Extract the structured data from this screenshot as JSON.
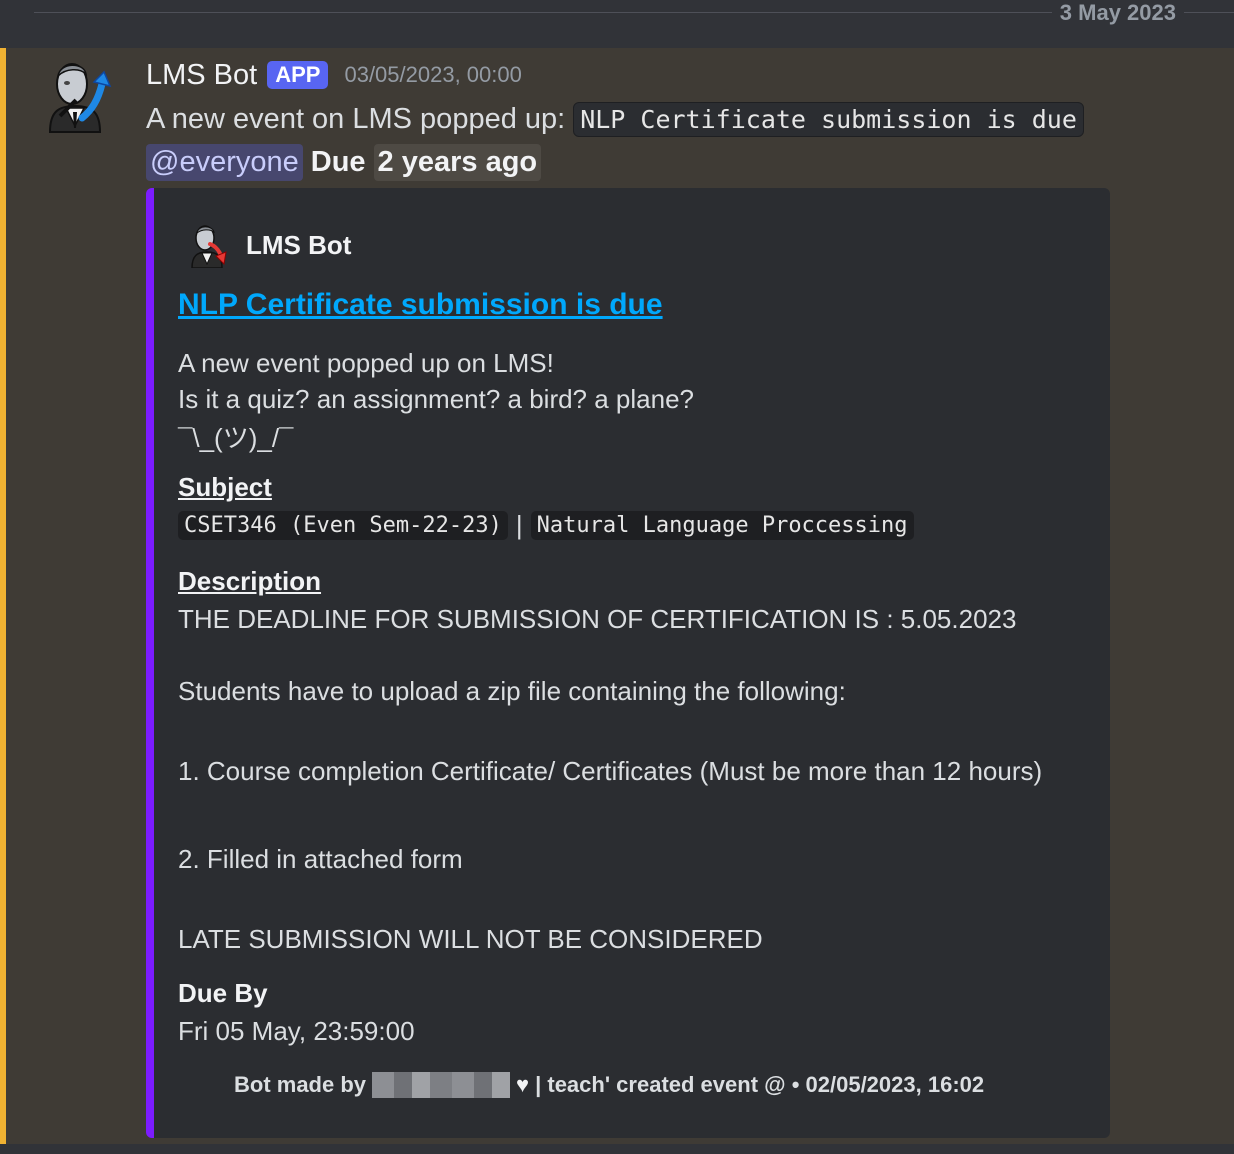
{
  "divider": {
    "date": "3 May 2023"
  },
  "message": {
    "author": "LMS Bot",
    "tag": "APP",
    "timestamp": "03/05/2023, 00:00",
    "intro_text": "A new event on LMS popped up:",
    "event_code": "NLP Certificate submission is due",
    "mention": "@everyone",
    "due_label": "Due",
    "relative_time": "2 years ago"
  },
  "embed": {
    "accent_color": "#7c1cff",
    "author": "LMS Bot",
    "title": "NLP Certificate submission is due",
    "intro_lines": [
      "A new event popped up on LMS!",
      "Is it a quiz? an assignment? a bird? a plane?",
      "¯\\_(ツ)_/¯"
    ],
    "subject_label": "Subject",
    "subject_code": "CSET346 (Even Sem-22-23)",
    "subject_sep": "|",
    "subject_name": "Natural Language Proccessing",
    "description_label": "Description",
    "description_lines": [
      "THE DEADLINE FOR SUBMISSION OF CERTIFICATION IS : 5.05.2023",
      "Students have to upload a zip file containing the following:",
      "1. Course completion Certificate/ Certificates (Must be more than 12 hours)",
      "2. Filled in attached form",
      "LATE SUBMISSION WILL NOT BE CONSIDERED"
    ],
    "due_by_label": "Due By",
    "due_by_value": "Fri 05 May, 23:59:00",
    "footer_prefix": "Bot made by",
    "footer_heart": "♥",
    "footer_rest": "| teach' created event @ • 02/05/2023, 16:02"
  },
  "colors": {
    "background": "#313338",
    "highlight_bg": "#3f3b35",
    "mention_bar": "#f0b232",
    "link": "#00a8fc",
    "app_tag": "#5865f2"
  }
}
